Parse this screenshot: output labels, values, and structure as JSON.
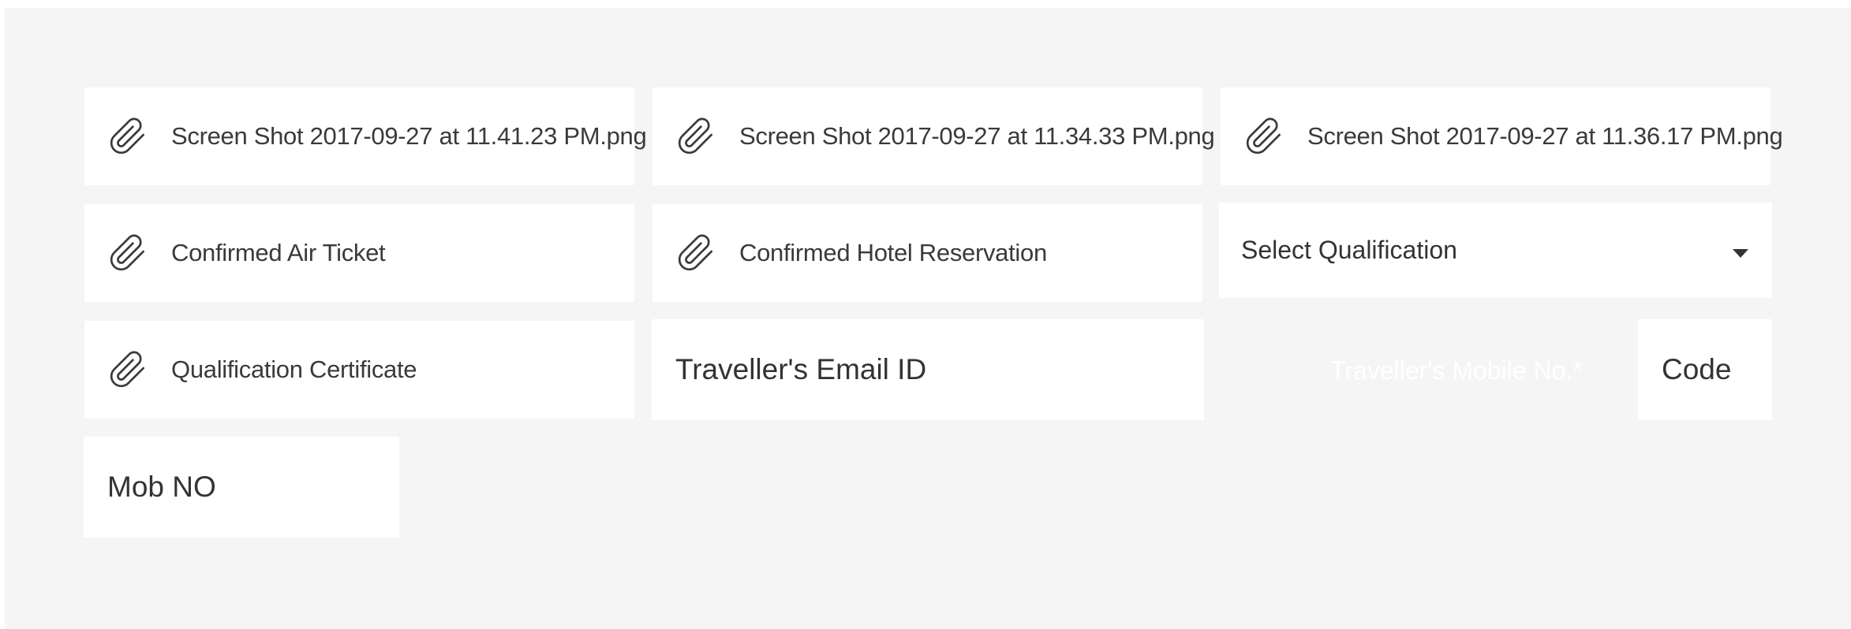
{
  "attachments": [
    {
      "label": "Screen Shot 2017-09-27 at 11.41.23 PM.png",
      "icon": "paperclip-icon"
    },
    {
      "label": "Screen Shot 2017-09-27 at 11.34.33 PM.png",
      "icon": "paperclip-icon"
    },
    {
      "label": "Screen Shot 2017-09-27 at 11.36.17 PM.png",
      "icon": "paperclip-icon"
    },
    {
      "label": "Confirmed Air Ticket",
      "icon": "paperclip-icon"
    },
    {
      "label": "Confirmed Hotel Reservation",
      "icon": "paperclip-icon"
    },
    {
      "label": "Qualification Certificate",
      "icon": "paperclip-icon"
    }
  ],
  "qualification_select": {
    "selected": "Select Qualification",
    "icon": "caret-down-icon"
  },
  "email_input": {
    "placeholder": "Traveller's Email ID"
  },
  "mobile_label": "Traveller's Mobile No.*",
  "code_input": {
    "placeholder": "Code"
  },
  "mob_input": {
    "placeholder": "Mob NO"
  },
  "colors": {
    "panel_background": "#f5f5f5",
    "field_background": "#ffffff",
    "text": "#333333"
  }
}
